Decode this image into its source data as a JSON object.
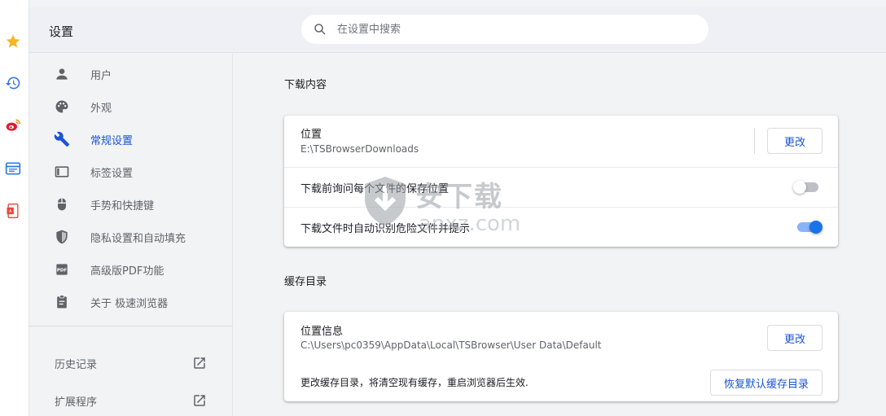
{
  "header": {
    "title": "设置",
    "search_placeholder": "在设置中搜索"
  },
  "rail": {
    "icons": [
      "star-icon",
      "history-icon",
      "weibo-icon",
      "browser-window-icon",
      "pdf-app-icon"
    ]
  },
  "sidebar": {
    "items": [
      {
        "label": "用户",
        "icon": "person-icon"
      },
      {
        "label": "外观",
        "icon": "palette-icon"
      },
      {
        "label": "常规设置",
        "icon": "wrench-icon",
        "active": true
      },
      {
        "label": "标签设置",
        "icon": "tab-icon"
      },
      {
        "label": "手势和快捷键",
        "icon": "mouse-icon"
      },
      {
        "label": "隐私设置和自动填充",
        "icon": "shield-icon"
      },
      {
        "label": "高级版PDF功能",
        "icon": "pdf-icon"
      },
      {
        "label": "关于 极速浏览器",
        "icon": "clipboard-icon"
      }
    ],
    "extras": [
      {
        "label": "历史记录",
        "icon": "open-external-icon"
      },
      {
        "label": "扩展程序",
        "icon": "open-external-icon"
      }
    ]
  },
  "downloads": {
    "section_title": "下载内容",
    "location_label": "位置",
    "location_value": "E:\\TSBrowserDownloads",
    "change_button": "更改",
    "ask_label": "下载前询问每个文件的保存位置",
    "ask_enabled": false,
    "danger_label": "下载文件时自动识别危险文件并提示",
    "danger_enabled": true
  },
  "cache": {
    "section_title": "缓存目录",
    "location_label": "位置信息",
    "location_value": "C:\\Users\\pc0359\\AppData\\Local\\TSBrowser\\User Data\\Default",
    "change_button": "更改",
    "note": "更改缓存目录，将清空现有缓存，重启浏览器后生效.",
    "restore_button": "恢复默认缓存目录"
  },
  "watermark": {
    "text_cn": "安下载",
    "text_en": "anxz.com"
  },
  "colors": {
    "accent": "#1a53d6",
    "toggle_on": "#1a73e8",
    "background": "#f1f3f4",
    "header": "#eef0f6"
  }
}
